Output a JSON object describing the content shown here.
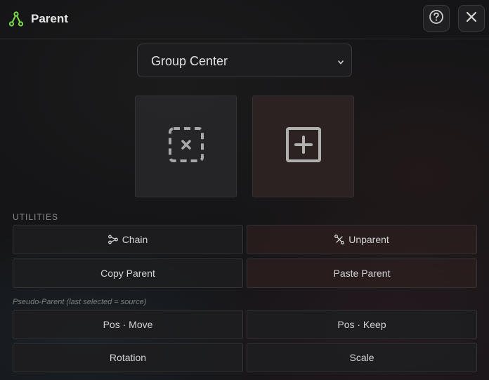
{
  "header": {
    "title": "Parent",
    "app_icon": "fork-icon",
    "help_icon": "question-circle-icon",
    "close_icon": "close-icon",
    "accent_color": "#7ddc4a"
  },
  "mode_select": {
    "value": "Group Center"
  },
  "tiles": {
    "clear": {
      "icon": "dashed-box-x-icon"
    },
    "add": {
      "icon": "box-plus-icon"
    }
  },
  "utilities": {
    "section_label": "UTILITIES",
    "chain_label": "Chain",
    "unparent_label": "Unparent",
    "copy_parent_label": "Copy Parent",
    "paste_parent_label": "Paste Parent"
  },
  "pseudo_parent": {
    "section_label": "Pseudo-Parent (last selected = source)",
    "pos_move_label": "Pos · Move",
    "pos_keep_label": "Pos · Keep",
    "rotation_label": "Rotation",
    "scale_label": "Scale"
  }
}
